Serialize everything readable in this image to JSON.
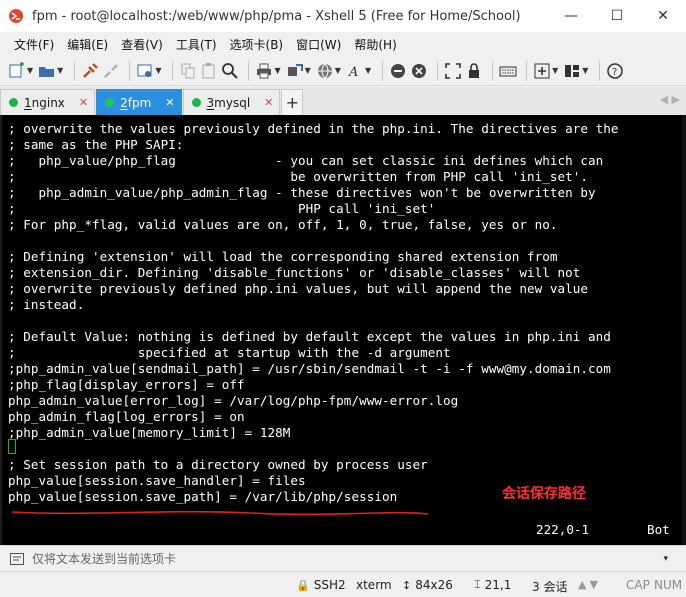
{
  "window": {
    "title": "fpm - root@localhost:/web/www/php/pma - Xshell 5 (Free for Home/School)",
    "minimize": "—",
    "maximize": "☐",
    "close": "✕"
  },
  "menu": [
    {
      "label": "文件(F)"
    },
    {
      "label": "编辑(E)"
    },
    {
      "label": "查看(V)"
    },
    {
      "label": "工具(T)"
    },
    {
      "label": "选项卡(B)"
    },
    {
      "label": "窗口(W)"
    },
    {
      "label": "帮助(H)"
    }
  ],
  "tabs": [
    {
      "num": "1",
      "name": " nginx",
      "close": "✕",
      "active": false
    },
    {
      "num": "2",
      "name": " fpm",
      "close": "✕",
      "active": true
    },
    {
      "num": "3",
      "name": " mysql",
      "close": "✕",
      "active": false
    }
  ],
  "tab_add": "+",
  "tab_nav": "◀ ▶",
  "terminal": {
    "lines": [
      "; overwrite the values previously defined in the php.ini. The directives are the",
      "; same as the PHP SAPI:",
      ";   php_value/php_flag             - you can set classic ini defines which can",
      ";                                    be overwritten from PHP call 'ini_set'.",
      ";   php_admin_value/php_admin_flag - these directives won't be overwritten by",
      ";                                     PHP call 'ini_set'",
      "; For php_*flag, valid values are on, off, 1, 0, true, false, yes or no.",
      "",
      "; Defining 'extension' will load the corresponding shared extension from",
      "; extension_dir. Defining 'disable_functions' or 'disable_classes' will not",
      "; overwrite previously defined php.ini values, but will append the new value",
      "; instead.",
      "",
      "; Default Value: nothing is defined by default except the values in php.ini and",
      ";                specified at startup with the -d argument",
      ";php_admin_value[sendmail_path] = /usr/sbin/sendmail -t -i -f www@my.domain.com",
      ";php_flag[display_errors] = off",
      "php_admin_value[error_log] = /var/log/php-fpm/www-error.log",
      "php_admin_flag[log_errors] = on",
      ";php_admin_value[memory_limit] = 128M",
      "",
      "; Set session path to a directory owned by process user",
      "php_value[session.save_handler] = files",
      "php_value[session.save_path] = /var/lib/php/session"
    ],
    "annotation": "会话保存路径",
    "position": "222,0-1",
    "scroll_state": "Bot"
  },
  "compose": {
    "placeholder": "仅将文本发送到当前选项卡",
    "caret": "▾"
  },
  "statusbar": {
    "protocol": "SSH2",
    "terminal_type": "xterm",
    "size": "84x26",
    "cursor": "21,1",
    "sessions": "3 会话",
    "caps": "CAP",
    "num": "NUM"
  },
  "colors": {
    "terminal_bg": "#000000",
    "terminal_fg": "#ffffff",
    "annotation": "#ff3030",
    "active_tab": "#2b8fe0",
    "session_dot": "#22b24c"
  }
}
